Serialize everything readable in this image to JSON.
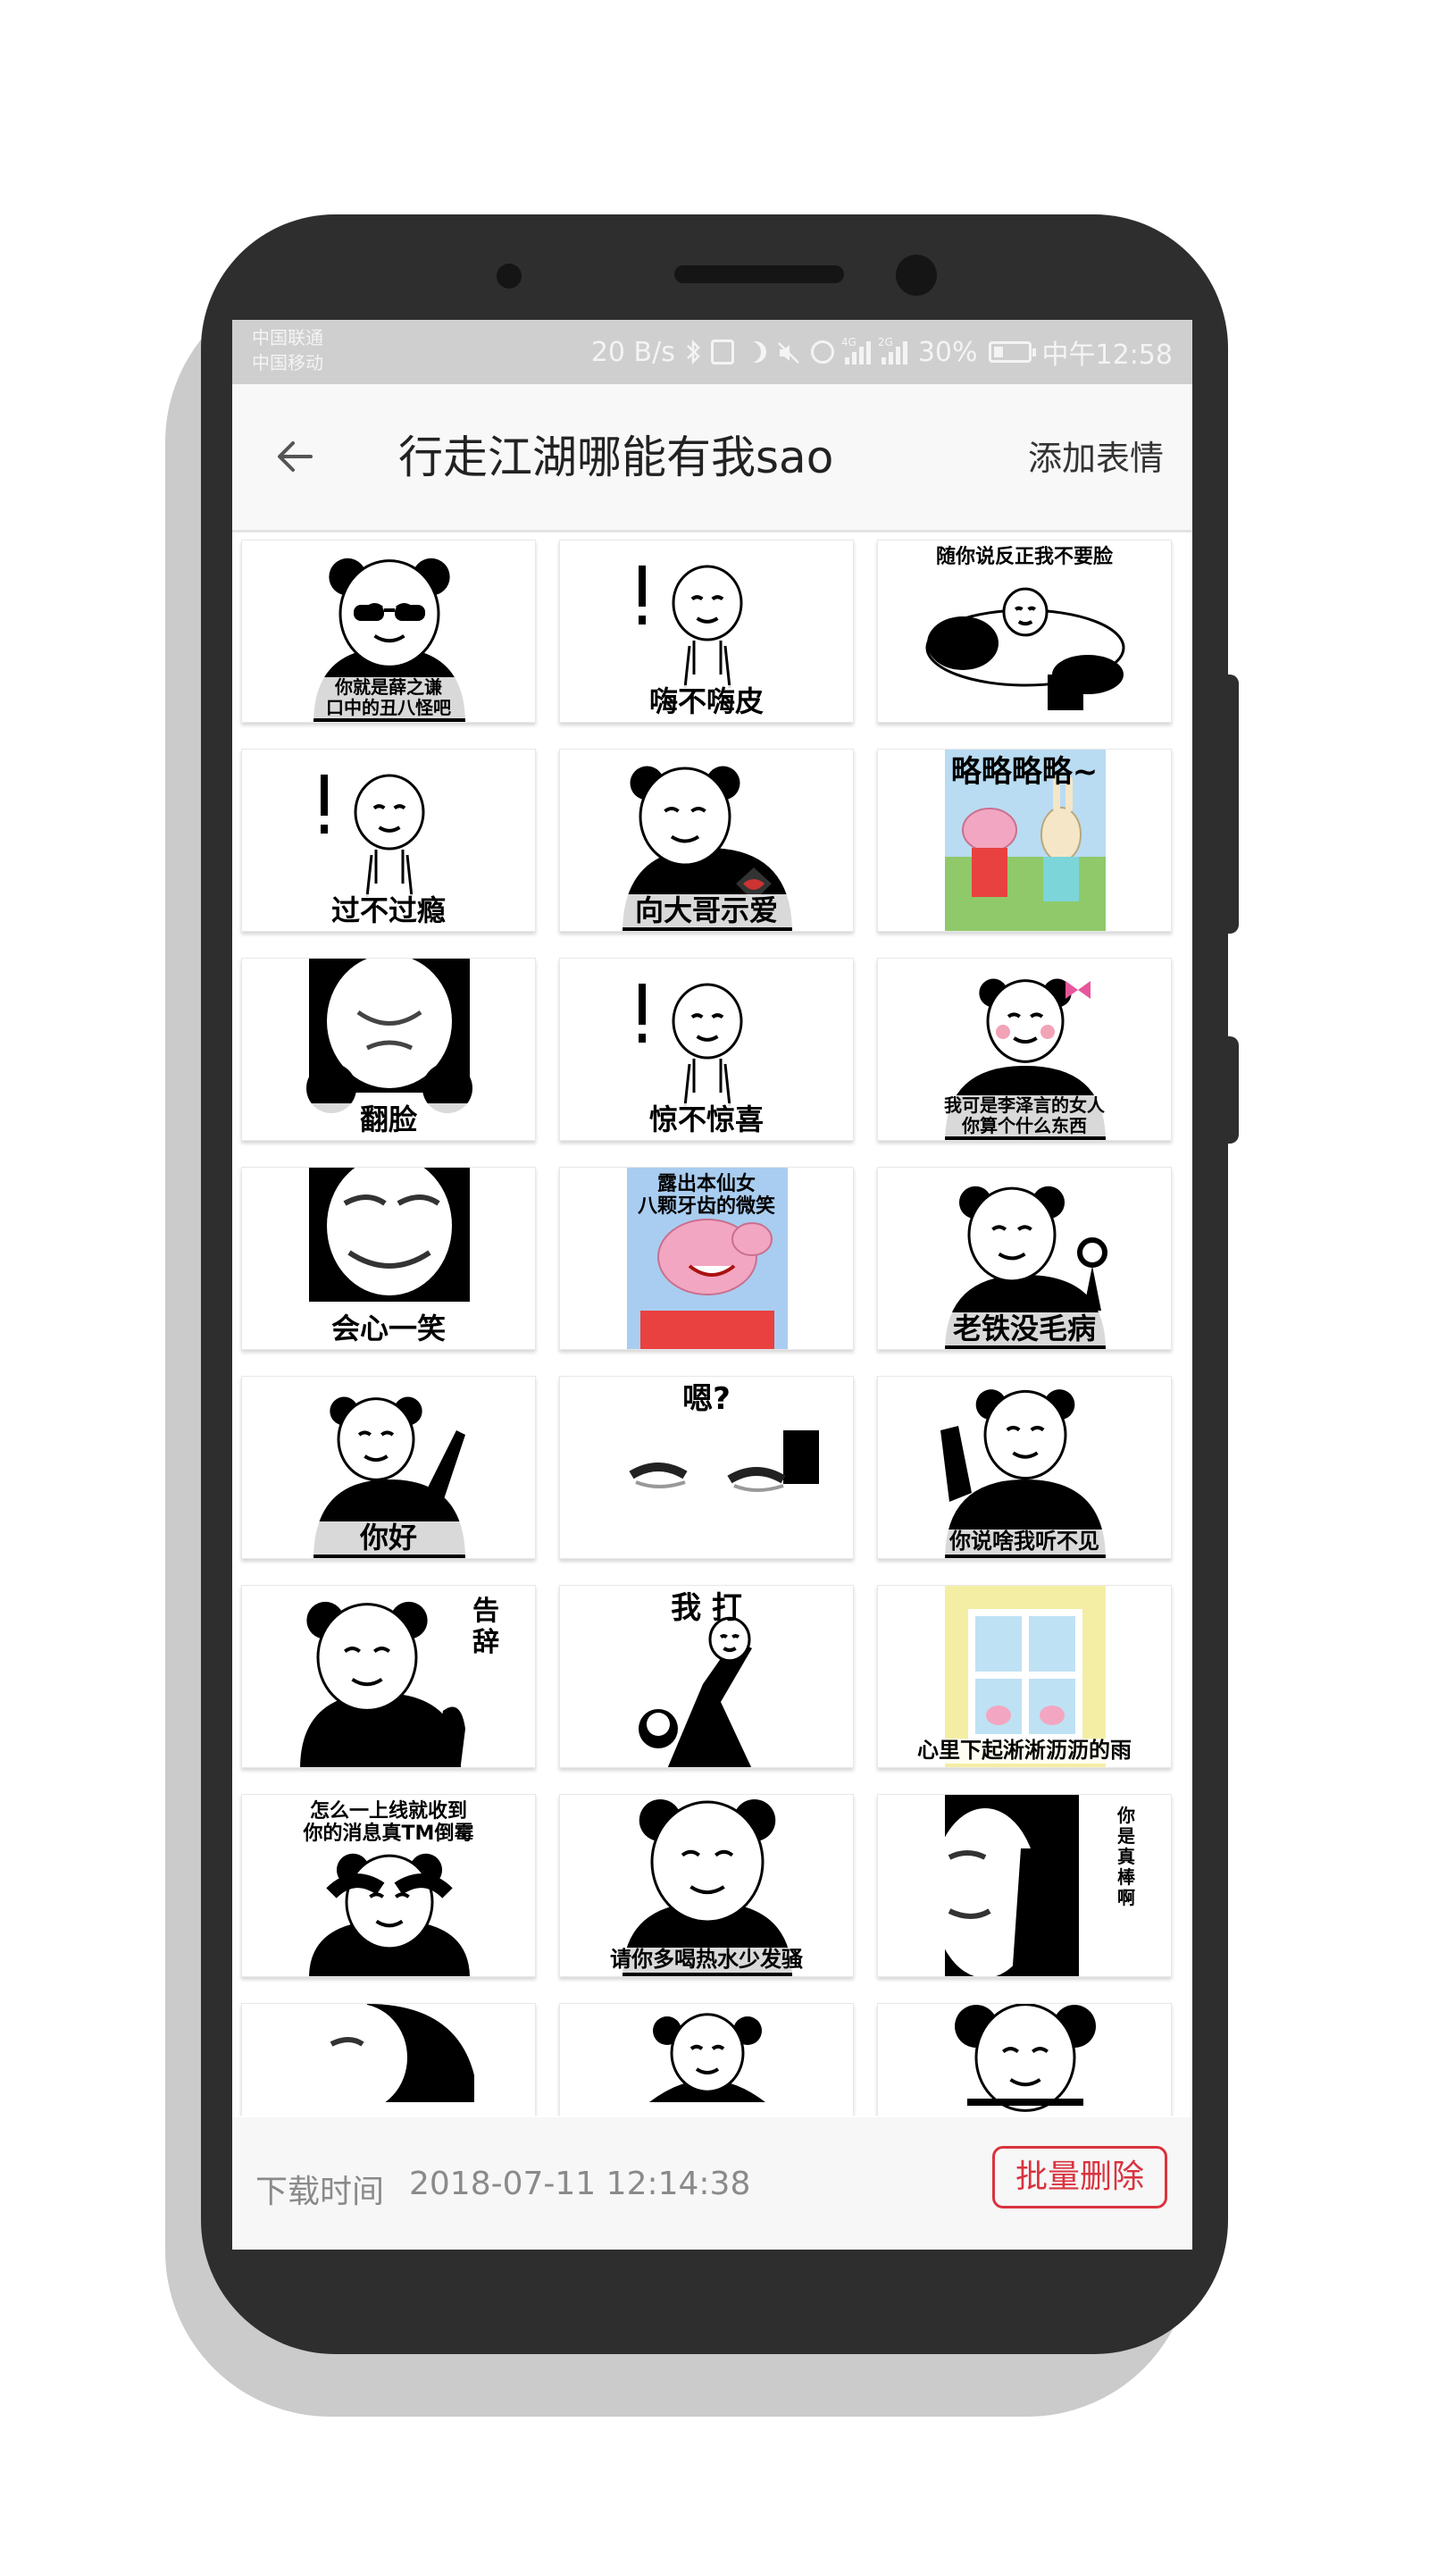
{
  "status_bar": {
    "carrier_1": "中国联通",
    "carrier_2": "中国移动",
    "net_speed": "20 B/s",
    "signal_1_tag": "4G",
    "signal_2_tag": "2G",
    "battery_percent": "30%",
    "battery_level": 0.3,
    "time": "中午12:58"
  },
  "app_bar": {
    "title": "行走江湖哪能有我sao",
    "action_label": "添加表情"
  },
  "stickers": [
    {
      "caption": "你就是薛之谦\n口中的丑八怪吧",
      "kind": "panda-sunglasses",
      "caption_pos": "bottom"
    },
    {
      "caption": "嗨不嗨皮",
      "kind": "stickman",
      "caption_pos": "bottom"
    },
    {
      "caption": "随你说反正我不要脸",
      "kind": "panda-lying",
      "caption_pos": "top"
    },
    {
      "caption": "过不过瘾",
      "kind": "stickman",
      "caption_pos": "bottom"
    },
    {
      "caption": "向大哥示爱",
      "kind": "panda-heart",
      "caption_pos": "bottom"
    },
    {
      "caption": "略略略略~",
      "kind": "peppa-rabbit",
      "caption_pos": "top"
    },
    {
      "caption": "翻脸",
      "kind": "panda-upside",
      "caption_pos": "bottom"
    },
    {
      "caption": "惊不惊喜",
      "kind": "stickman",
      "caption_pos": "bottom"
    },
    {
      "caption": "我可是李泽言的女人\n你算个什么东西",
      "kind": "panda-bow",
      "caption_pos": "bottom"
    },
    {
      "caption": "会心一笑",
      "kind": "panda-smile-close",
      "caption_pos": "bottom"
    },
    {
      "caption": "露出本仙女\n八颗牙齿的微笑",
      "kind": "peppa-smile",
      "caption_pos": "top"
    },
    {
      "caption": "老铁没毛病",
      "kind": "panda-ok",
      "caption_pos": "bottom"
    },
    {
      "caption": "你好",
      "kind": "panda-wave",
      "caption_pos": "bottom"
    },
    {
      "caption": "嗯?",
      "kind": "eyes-closeup",
      "caption_pos": "top"
    },
    {
      "caption": "你说啥我听不见",
      "kind": "panda-ear",
      "caption_pos": "bottom"
    },
    {
      "caption": "告\n辞",
      "kind": "panda-bye",
      "caption_pos": "right"
    },
    {
      "caption": "我 打",
      "kind": "panda-fight",
      "caption_pos": "top"
    },
    {
      "caption": "心里下起淅淅沥沥的雨",
      "kind": "peppa-window",
      "caption_pos": "bottom"
    },
    {
      "caption": "怎么一上线就收到\n你的消息真TM倒霉",
      "kind": "panda-facepalm",
      "caption_pos": "top"
    },
    {
      "caption": "请你多喝热水少发骚",
      "kind": "panda-sad",
      "caption_pos": "bottom"
    },
    {
      "caption": "你\n是\n真\n棒\n啊",
      "kind": "panda-thumb",
      "caption_pos": "right"
    },
    {
      "caption": "",
      "kind": "panda-finger",
      "caption_pos": "none"
    },
    {
      "caption": "",
      "kind": "panda-small",
      "caption_pos": "none"
    },
    {
      "caption": "",
      "kind": "panda-wink",
      "caption_pos": "none"
    }
  ],
  "footer": {
    "download_label": "下载时间",
    "download_time": "2018-07-11 12:14:38",
    "delete_button": "批量删除"
  },
  "colors": {
    "accent_red": "#d9333f",
    "status_bar_bg": "#cfcfcf",
    "app_bar_bg": "#f8f8f8",
    "phone_body": "#2e2e2e"
  }
}
